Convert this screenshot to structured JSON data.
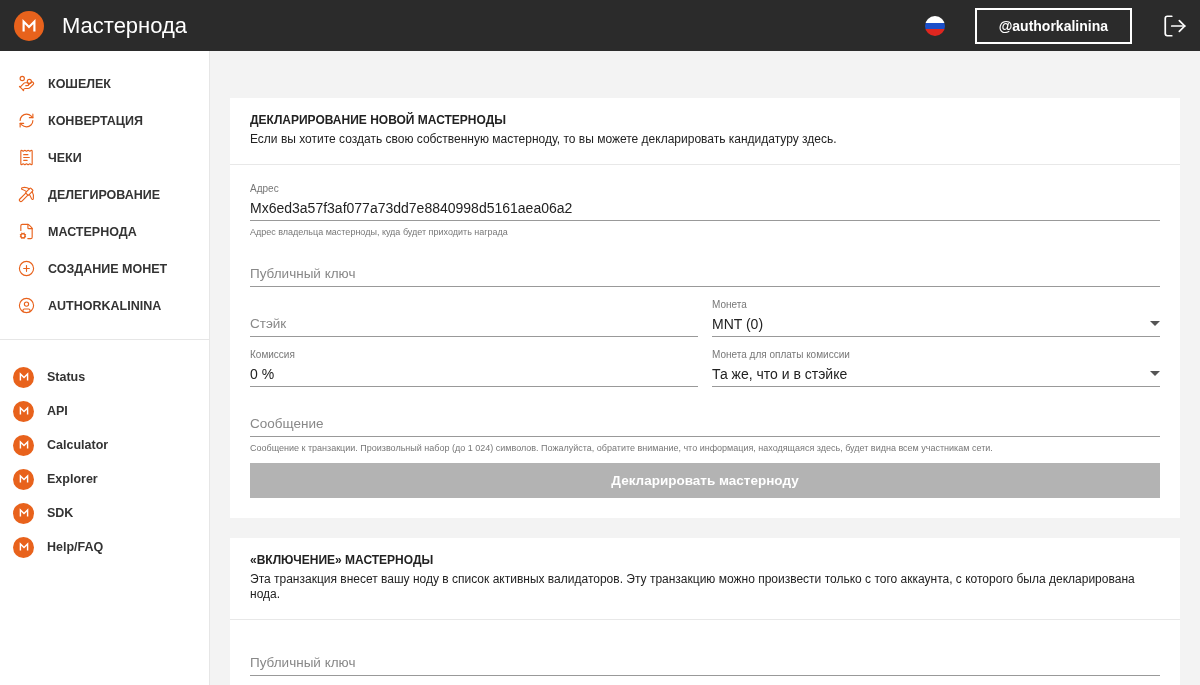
{
  "header": {
    "title": "Мастернода",
    "user": "@authorkalinina"
  },
  "nav": [
    "КОШЕЛЕК",
    "КОНВЕРТАЦИЯ",
    "ЧЕКИ",
    "ДЕЛЕГИРОВАНИЕ",
    "МАСТЕРНОДА",
    "СОЗДАНИЕ МОНЕТ",
    "AUTHORKALININA"
  ],
  "links": [
    "Status",
    "API",
    "Calculator",
    "Explorer",
    "SDK",
    "Help/FAQ"
  ],
  "cards": [
    {
      "title": "ДЕКЛАРИРОВАНИЕ НОВОЙ МАСТЕРНОДЫ",
      "description": "Если вы хотите создать свою собственную мастерноду, то вы можете декларировать кандидатуру здесь.",
      "rows": [
        [
          {
            "kind": "text",
            "label": "Адрес",
            "value": "Mx6ed3a57f3af077a73dd7e8840998d5161aea06a2",
            "hint": "Адрес владельца мастерноды, куда будет приходить награда"
          }
        ],
        [
          {
            "kind": "text",
            "placeholder": "Публичный ключ"
          }
        ],
        [
          {
            "kind": "text",
            "placeholder": "Стэйк"
          },
          {
            "kind": "select",
            "label": "Монета",
            "value": "MNT (0)"
          }
        ],
        [
          {
            "kind": "text",
            "label": "Комиссия",
            "value": "0 %"
          },
          {
            "kind": "select",
            "label": "Монета для оплаты комиссии",
            "value": "Та же, что и в стэйке"
          }
        ],
        [
          {
            "kind": "text",
            "placeholder": "Сообщение",
            "hint": "Сообщение к транзакции. Произвольный набор (до 1 024) символов. Пожалуйста, обратите внимание, что информация, находящаяся здесь, будет видна всем участникам сети."
          }
        ]
      ],
      "button": {
        "label": "Декларировать мастерноду",
        "disabled": true
      }
    },
    {
      "title": "«ВКЛЮЧЕНИЕ» МАСТЕРНОДЫ",
      "description": "Эта транзакция внесет вашу ноду в список активных валидаторов. Эту транзакцию можно произвести только с того аккаунта, с которого была декларирована нода.",
      "rows": [
        [
          {
            "kind": "text",
            "placeholder": "Публичный ключ"
          }
        ]
      ]
    }
  ]
}
